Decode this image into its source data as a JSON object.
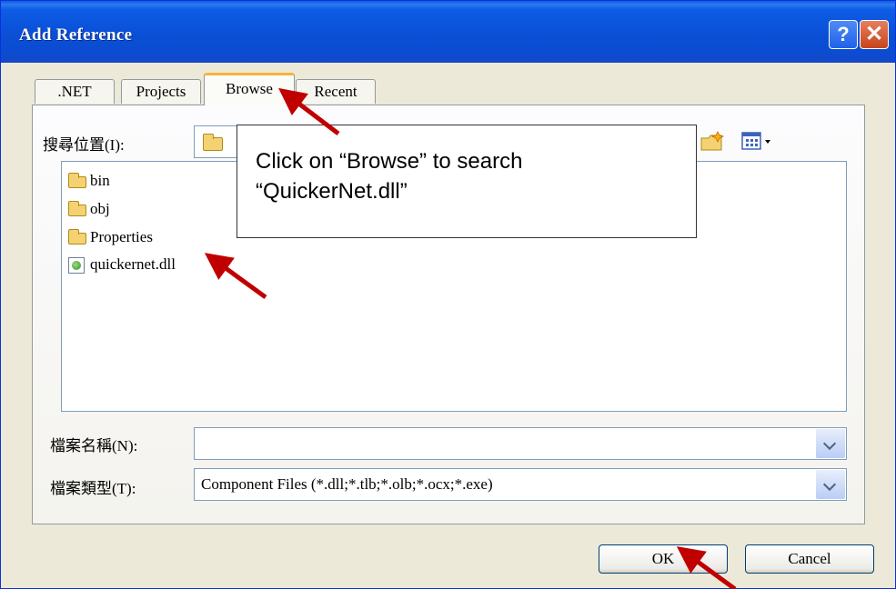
{
  "window": {
    "title": "Add Reference"
  },
  "titlebar": {
    "help_glyph": "?",
    "close_glyph": "✕"
  },
  "tabs": [
    {
      "label": ".NET"
    },
    {
      "label": "Projects"
    },
    {
      "label": "Browse",
      "selected": true
    },
    {
      "label": "Recent"
    }
  ],
  "lookin": {
    "label": "搜尋位置(I):"
  },
  "files": [
    {
      "name": "bin",
      "icon": "folder-icon"
    },
    {
      "name": "obj",
      "icon": "folder-icon"
    },
    {
      "name": "Properties",
      "icon": "folder-icon"
    },
    {
      "name": "quickernet.dll",
      "icon": "dll-file-icon"
    }
  ],
  "filename": {
    "label": "檔案名稱(N):",
    "value": ""
  },
  "filetype": {
    "label": "檔案類型(T):",
    "value": "Component Files (*.dll;*.tlb;*.olb;*.ocx;*.exe)"
  },
  "buttons": {
    "ok": "OK",
    "cancel": "Cancel"
  },
  "callout": {
    "line1": "Click on “Browse” to search",
    "line2": "“QuickerNet.dll”"
  },
  "colors": {
    "titlebar": "#0a4fd6",
    "dialog": "#ece9d8",
    "arrow": "#c00000",
    "active_tab_accent": "#f7b437"
  }
}
